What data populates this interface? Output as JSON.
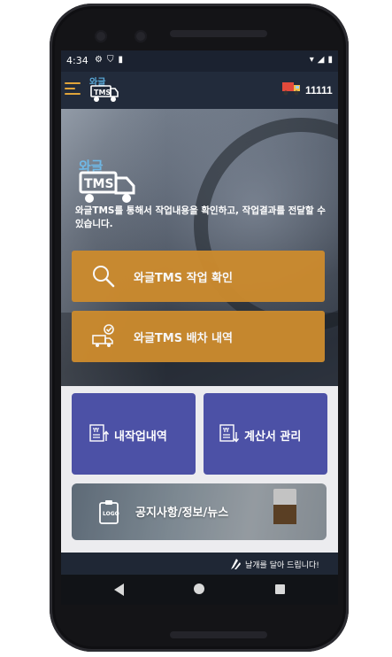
{
  "status_bar": {
    "time": "4:34",
    "left_icons": [
      "gear-icon",
      "shield-icon",
      "sdcard-icon"
    ],
    "right_icons": [
      "wifi-icon",
      "signal-icon",
      "battery-icon"
    ]
  },
  "app_bar": {
    "logo_text_top": "와글",
    "logo_text_bottom": "TMS",
    "user_id": "11111"
  },
  "hero": {
    "logo_text_top": "와글",
    "logo_text_bottom": "TMS",
    "description": "와글TMS를 통해서 작업내용을 확인하고, 작업결과를 전달할 수 있습니다."
  },
  "buttons": [
    {
      "label": "와글TMS 작업 확인",
      "icon": "search-icon"
    },
    {
      "label": "와글TMS 배차 내역",
      "icon": "truck-check-icon"
    }
  ],
  "tiles": [
    {
      "label": "내작업내역",
      "icon": "invoice-upload-icon"
    },
    {
      "label": "계산서 관리",
      "icon": "invoice-download-icon"
    }
  ],
  "notice": {
    "label": "공지사항/정보/뉴스",
    "icon": "clipboard-logo-icon"
  },
  "footer": {
    "text": "날개를 달아 드립니다!",
    "icon": "wing-icon"
  },
  "colors": {
    "accent_orange": "#cc8b2e",
    "tile_purple": "#4c51a6",
    "app_bar": "#222b3b",
    "menu_icon": "#e0a43a"
  }
}
